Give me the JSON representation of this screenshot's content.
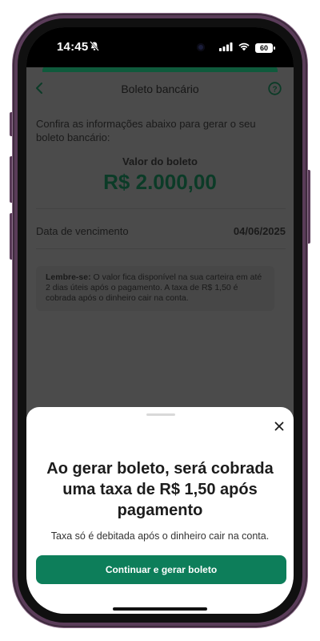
{
  "status_bar": {
    "time": "14:45",
    "battery": "60",
    "icons": [
      "bell-slash-icon",
      "signal-icon",
      "wifi-icon",
      "battery-icon"
    ]
  },
  "header": {
    "title": "Boleto bancário",
    "back_icon": "chevron-left-icon",
    "help_icon": "question-circle-icon"
  },
  "content": {
    "intro": "Confira as informações abaixo para gerar o seu boleto bancário:",
    "amount_label": "Valor do boleto",
    "amount_value": "R$ 2.000,00",
    "due_date_label": "Data de vencimento",
    "due_date_value": "04/06/2025",
    "reminder_title": "Lembre-se:",
    "reminder_text": " O valor fica disponível na sua carteira em até 2 dias úteis após o pagamento. A taxa de R$ 1,50 é cobrada após o dinheiro cair na conta."
  },
  "sheet": {
    "title": "Ao gerar boleto, será cobrada uma taxa de R$ 1,50 após pagamento",
    "subtitle": "Taxa só é debitada após o dinheiro cair na conta.",
    "button_label": "Continuar e gerar boleto",
    "close_icon": "close-icon"
  },
  "colors": {
    "accent_green": "#0d7e5a",
    "amount_green": "#0b3b27",
    "phone_frame": "#5a3c59"
  }
}
